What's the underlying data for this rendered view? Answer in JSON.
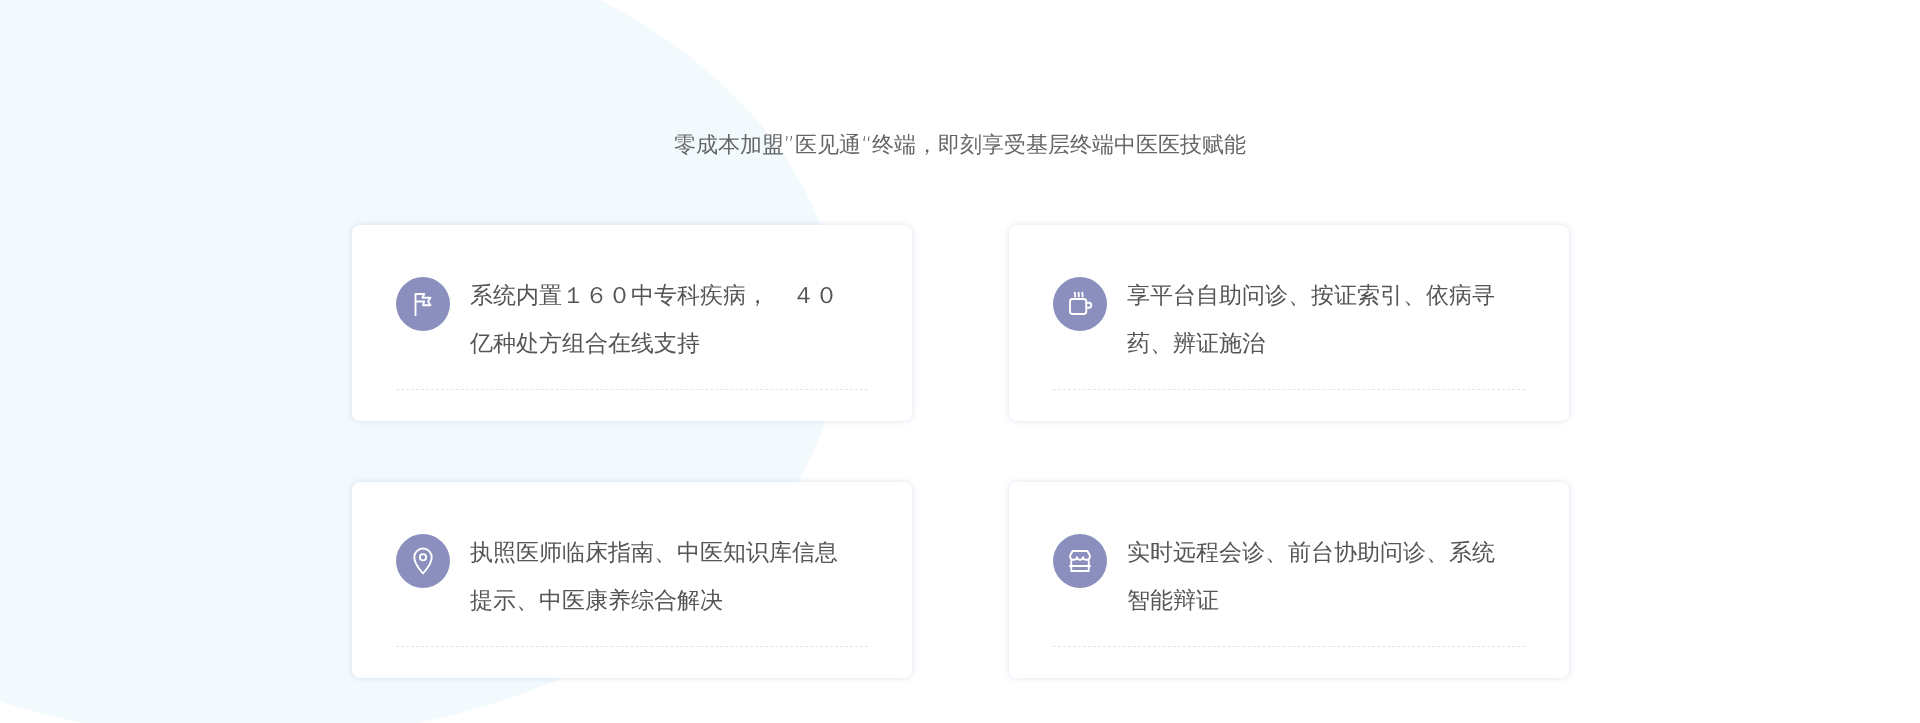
{
  "subtitle": "零成本加盟”医见通“终端，即刻享受基层终端中医医技赋能",
  "cards": [
    {
      "kind": "flag",
      "text": "系统内置１６０中专科疾病，　４０亿种处方组合在线支持"
    },
    {
      "kind": "cup",
      "text": "享平台自助问诊、按证索引、依病寻药、辨证施治"
    },
    {
      "kind": "pin",
      "text": "执照医师临床指南、中医知识库信息提示、中医康养综合解决"
    },
    {
      "kind": "store",
      "text": "实时远程会诊、前台协助问诊、系统智能辩证"
    }
  ]
}
